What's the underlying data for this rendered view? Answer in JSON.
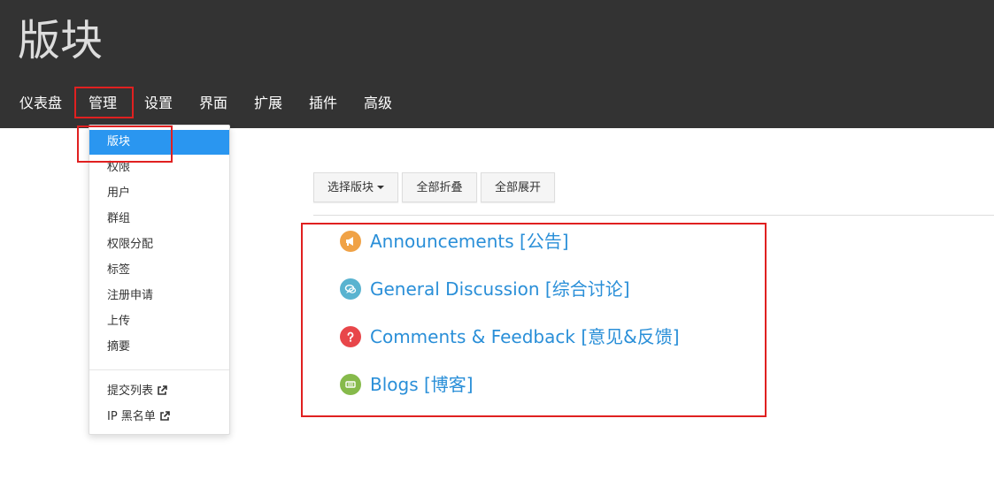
{
  "header": {
    "title": "版块",
    "background": "#333333",
    "nav": [
      "仪表盘",
      "管理",
      "设置",
      "界面",
      "扩展",
      "插件",
      "高级"
    ],
    "active_nav": "管理"
  },
  "dropdown": {
    "items": [
      "版块",
      "权限",
      "用户",
      "群组",
      "权限分配",
      "标签",
      "注册申请",
      "上传",
      "摘要"
    ],
    "active_item": "版块",
    "external_items": [
      "提交列表",
      "IP 黑名单"
    ]
  },
  "toolbar": {
    "select_label": "选择版块",
    "collapse_label": "全部折叠",
    "expand_label": "全部展开"
  },
  "categories": [
    {
      "title": "Announcements [公告]",
      "icon": "bullhorn-icon",
      "color": "#f0a246"
    },
    {
      "title": "General Discussion [综合讨论]",
      "icon": "comments-icon",
      "color": "#59b3d0"
    },
    {
      "title": "Comments & Feedback [意见&反馈]",
      "icon": "question-icon",
      "color": "#e8464a"
    },
    {
      "title": "Blogs [博客]",
      "icon": "newspaper-icon",
      "color": "#86ba4b"
    }
  ],
  "colors": {
    "accent": "#2a96f0",
    "link": "#2a8fd8",
    "highlight_box": "#e02020"
  }
}
